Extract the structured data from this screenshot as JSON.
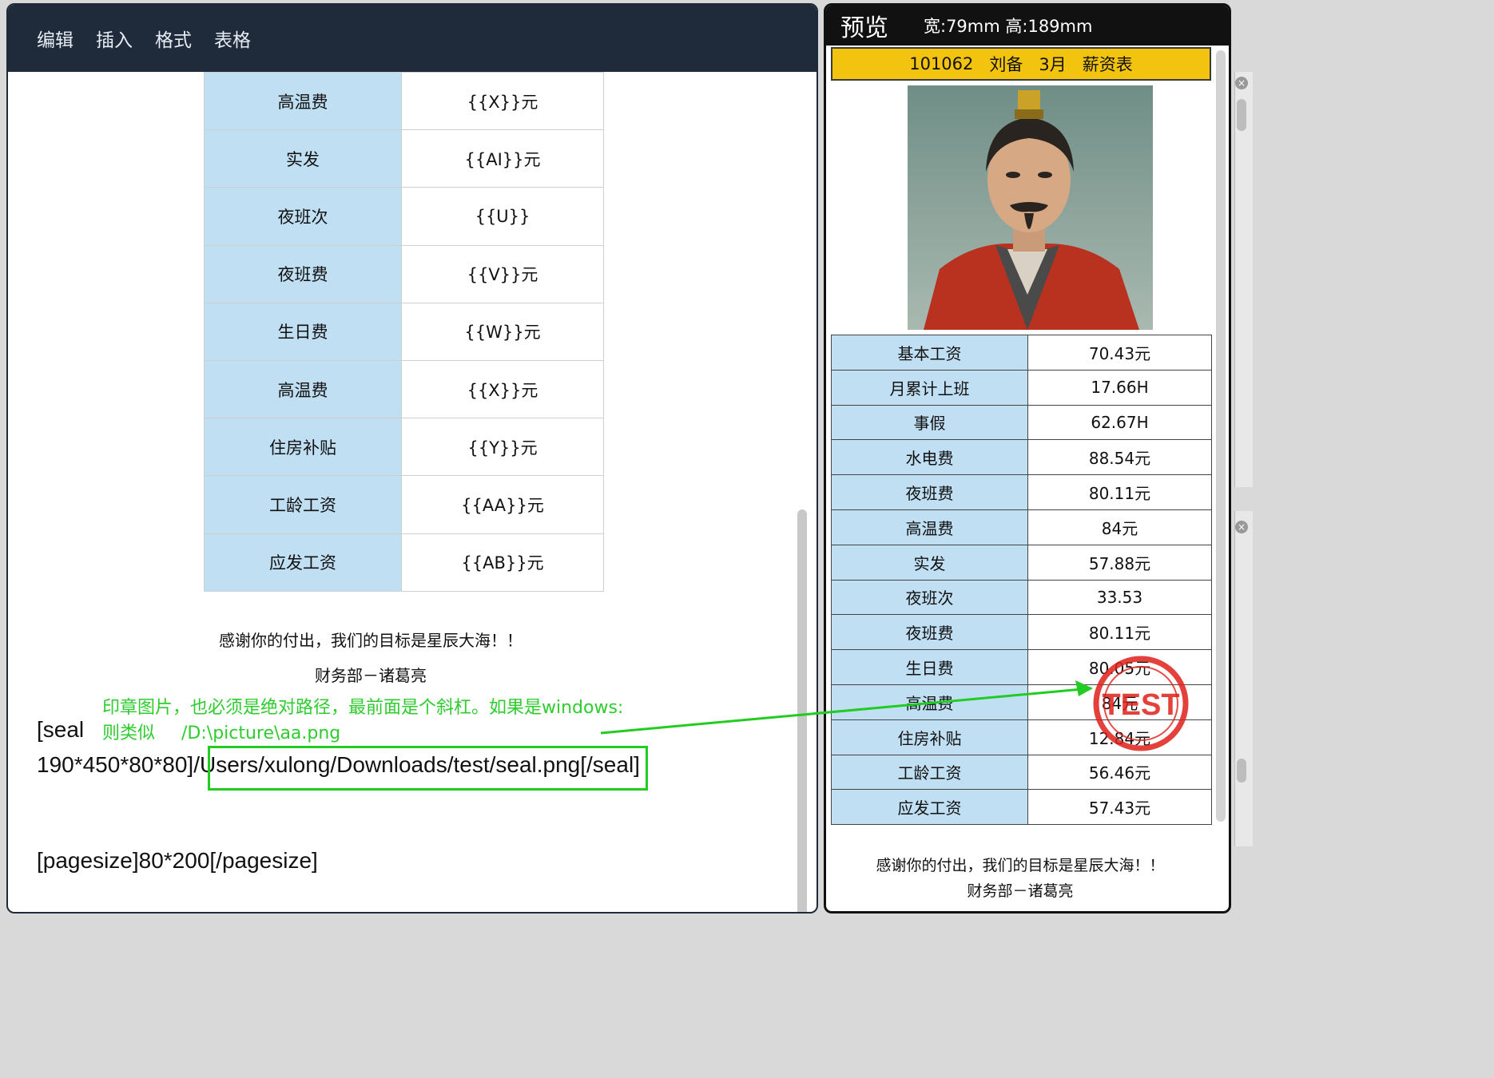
{
  "editor": {
    "menu": [
      "编辑",
      "插入",
      "格式",
      "表格"
    ],
    "table_rows": [
      {
        "label": "高温费",
        "value": "{{X}}元"
      },
      {
        "label": "实发",
        "value": "{{AI}}元"
      },
      {
        "label": "夜班次",
        "value": "{{U}}"
      },
      {
        "label": "夜班费",
        "value": "{{V}}元"
      },
      {
        "label": "生日费",
        "value": "{{W}}元"
      },
      {
        "label": "高温费",
        "value": "{{X}}元"
      },
      {
        "label": "住房补贴",
        "value": "{{Y}}元"
      },
      {
        "label": "工龄工资",
        "value": "{{AA}}元"
      },
      {
        "label": "应发工资",
        "value": "{{AB}}元"
      }
    ],
    "thanks_line": "感谢你的付出，我们的目标是星辰大海！！",
    "signature_line": "财务部－诸葛亮",
    "seal_open": "[seal",
    "seal_params": "190*450*80*80]",
    "seal_path": "/Users/xulong/Downloads/test/seal.png",
    "seal_close": "[/seal]",
    "pagesize_line": "[pagesize]80*200[/pagesize]",
    "note_line1": "印章图片，也必须是绝对路径，最前面是个斜杠。如果是windows:",
    "note_line2_prefix": "则类似",
    "note_line2_path": "/D:\\picture\\aa.png"
  },
  "preview": {
    "title": "预览",
    "dims": "宽:79mm 高:189mm",
    "banner": {
      "id": "101062",
      "name": "刘备",
      "month": "3月",
      "doc": "薪资表"
    },
    "rows": [
      {
        "label": "基本工资",
        "value": "70.43元"
      },
      {
        "label": "月累计上班",
        "value": "17.66H"
      },
      {
        "label": "事假",
        "value": "62.67H"
      },
      {
        "label": "水电费",
        "value": "88.54元"
      },
      {
        "label": "夜班费",
        "value": "80.11元"
      },
      {
        "label": "高温费",
        "value": "84元"
      },
      {
        "label": "实发",
        "value": "57.88元"
      },
      {
        "label": "夜班次",
        "value": "33.53"
      },
      {
        "label": "夜班费",
        "value": "80.11元"
      },
      {
        "label": "生日费",
        "value": "80.05元"
      },
      {
        "label": "高温费",
        "value": "84元"
      },
      {
        "label": "住房补贴",
        "value": "12.84元"
      },
      {
        "label": "工龄工资",
        "value": "56.46元"
      },
      {
        "label": "应发工资",
        "value": "57.43元"
      }
    ],
    "thanks_line": "感谢你的付出，我们的目标是星辰大海！！",
    "signature_line": "财务部－诸葛亮",
    "stamp_text": "TEST"
  },
  "colors": {
    "menubar": "#1f2a3a",
    "table_key_bg": "#c0dff3",
    "banner_bg": "#f2c40f",
    "annotation_green": "#22cc22",
    "stamp_red": "#e0201a"
  },
  "icons": [
    "close-icon",
    "portrait-image",
    "seal-stamp"
  ]
}
